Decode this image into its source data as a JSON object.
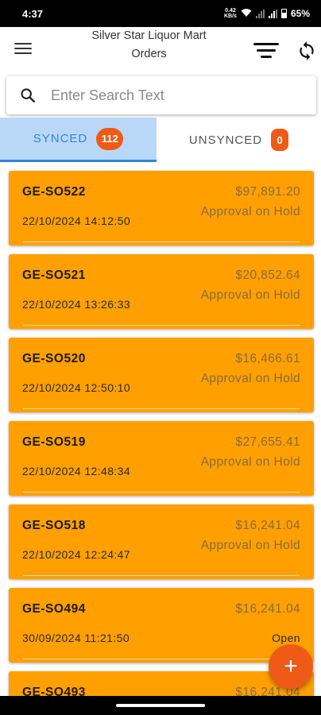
{
  "status_bar": {
    "time": "4:37",
    "network_speed": "0.42 KB/s",
    "battery_percent": "65%"
  },
  "header": {
    "store_name": "Silver Star Liquor Mart",
    "page_title": "Orders",
    "icons": [
      "menu-icon",
      "filter-icon",
      "sync-icon"
    ]
  },
  "search": {
    "value": "",
    "placeholder": "Enter Search Text"
  },
  "tabs": [
    {
      "label": "SYNCED",
      "count": "112",
      "active": true
    },
    {
      "label": "UNSYNCED",
      "count": "0",
      "active": false
    }
  ],
  "orders": [
    {
      "id": "GE-SO522",
      "date": "22/10/2024 14:12:50",
      "amount": "$97,891.20",
      "status": "Approval on Hold"
    },
    {
      "id": "GE-SO521",
      "date": "22/10/2024 13:26:33",
      "amount": "$20,852.64",
      "status": "Approval on Hold"
    },
    {
      "id": "GE-SO520",
      "date": "22/10/2024 12:50:10",
      "amount": "$16,466.61",
      "status": "Approval on Hold"
    },
    {
      "id": "GE-SO519",
      "date": "22/10/2024 12:48:34",
      "amount": "$27,655.41",
      "status": "Approval on Hold"
    },
    {
      "id": "GE-SO518",
      "date": "22/10/2024 12:24:47",
      "amount": "$16,241.04",
      "status": "Approval on Hold"
    },
    {
      "id": "GE-SO494",
      "date": "30/09/2024 11:21:50",
      "amount": "$16,241.04",
      "status": "Open"
    },
    {
      "id": "GE-SO493",
      "date": "",
      "amount": "$16,241.04",
      "status": ""
    }
  ],
  "fab": {
    "label": "+"
  },
  "colors": {
    "card": "#ffa000",
    "accent": "#ef5b17",
    "tab_active_bg": "#b9d8f8",
    "tab_active_text": "#2f86d6"
  }
}
